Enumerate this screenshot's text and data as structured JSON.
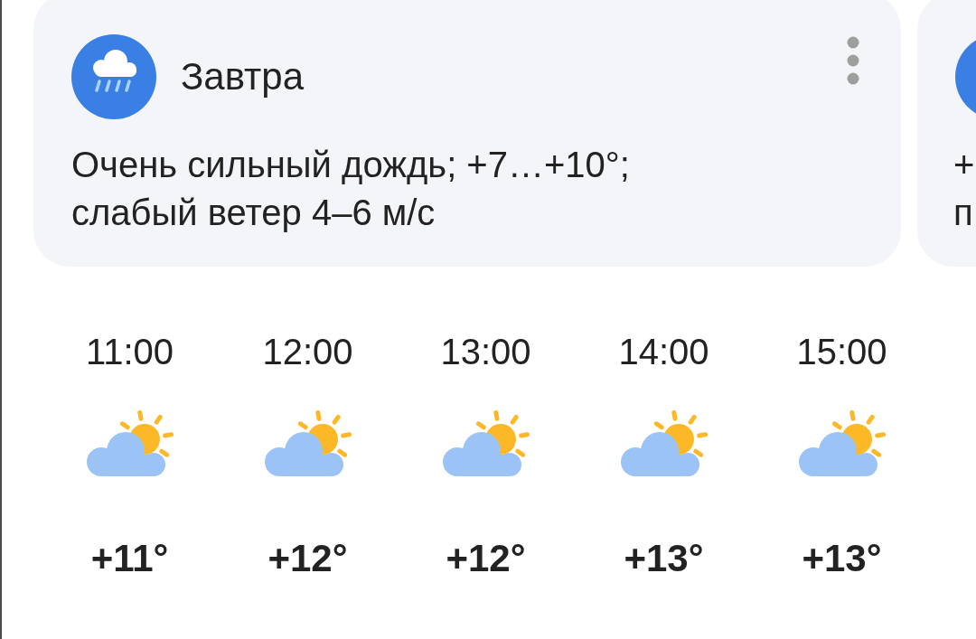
{
  "card": {
    "title": "Завтра",
    "description": "Очень сильный дождь; +7…+10°; слабый ветер 4–6 м/с"
  },
  "next_card": {
    "lines": [
      "+",
      "п"
    ]
  },
  "hours": [
    {
      "time": "11:00",
      "temperature": "+11°"
    },
    {
      "time": "12:00",
      "temperature": "+12°"
    },
    {
      "time": "13:00",
      "temperature": "+12°"
    },
    {
      "time": "14:00",
      "temperature": "+13°"
    },
    {
      "time": "15:00",
      "temperature": "+13°"
    }
  ]
}
